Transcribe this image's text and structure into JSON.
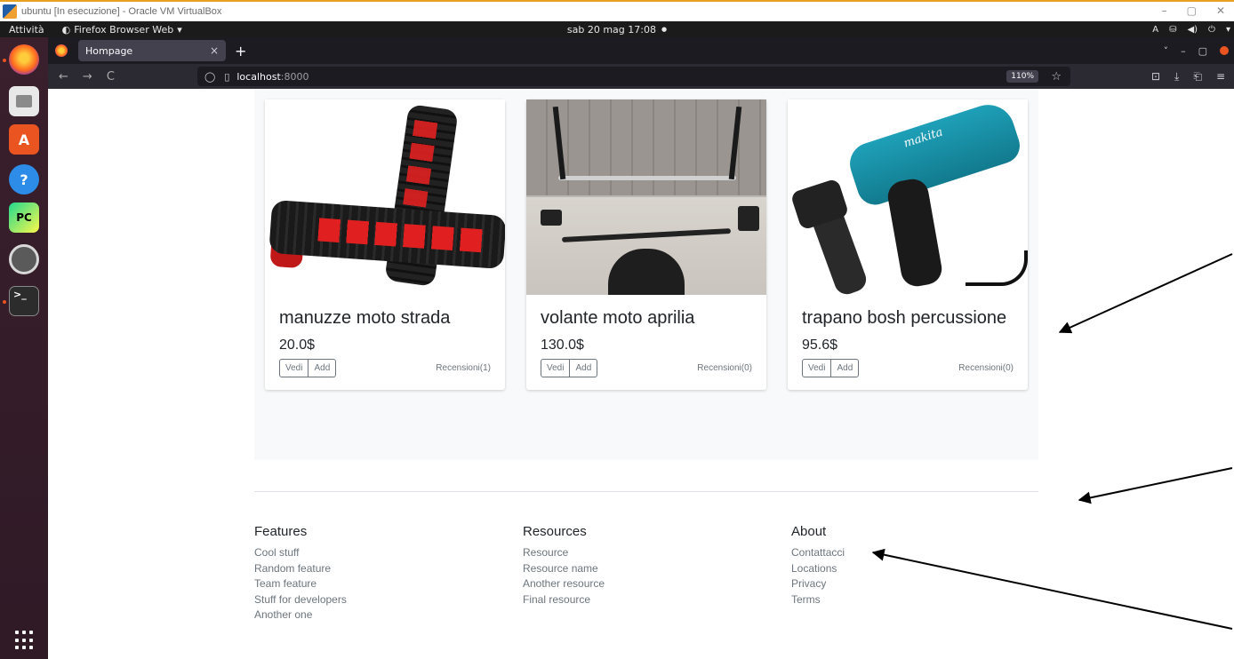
{
  "vbox": {
    "title": "ubuntu [In esecuzione] - Oracle VM VirtualBox",
    "min": "–",
    "max": "▢",
    "close": "✕"
  },
  "gnome": {
    "activities": "Attività",
    "app": "Firefox Browser Web",
    "app_arrow": "▾",
    "clock": "sab 20 mag  17:08",
    "clock_dot": "●",
    "tray": [
      "A",
      "⛁",
      "◀)",
      "⏻",
      "▾"
    ]
  },
  "browser": {
    "tab_title": "Hompage",
    "tab_close": "×",
    "new_tab": "+",
    "url_host": "localhost",
    "url_port": ":8000",
    "zoom": "110%",
    "nav": {
      "back": "←",
      "forward": "→",
      "reload": "C"
    },
    "toolbar_icons": [
      "⊡",
      "⤓",
      "⎗",
      "≡"
    ],
    "tabs_menu": "˅",
    "win_min": "–",
    "win_max": "▢"
  },
  "products": [
    {
      "title": "manuzze moto strada",
      "price": "20.0$",
      "view": "Vedi",
      "add": "Add",
      "reviews": "Recensioni(1)"
    },
    {
      "title": "volante moto aprilia",
      "price": "130.0$",
      "view": "Vedi",
      "add": "Add",
      "reviews": "Recensioni(0)"
    },
    {
      "title": "trapano bosh percussione",
      "price": "95.6$",
      "view": "Vedi",
      "add": "Add",
      "reviews": "Recensioni(0)"
    }
  ],
  "product_images": {
    "drill_brand": "makita"
  },
  "footer": {
    "features": {
      "heading": "Features",
      "links": [
        "Cool stuff",
        "Random feature",
        "Team feature",
        "Stuff for developers",
        "Another one"
      ]
    },
    "resources": {
      "heading": "Resources",
      "links": [
        "Resource",
        "Resource name",
        "Another resource",
        "Final resource"
      ]
    },
    "about": {
      "heading": "About",
      "links": [
        "Contattacci",
        "Locations",
        "Privacy",
        "Terms"
      ]
    }
  }
}
